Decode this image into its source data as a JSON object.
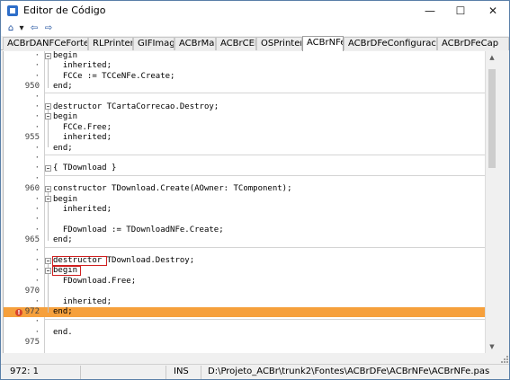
{
  "window": {
    "title": "Editor de Código",
    "controls": {
      "minimize": "—",
      "maximize": "☐",
      "close": "✕"
    }
  },
  "toolbar": {
    "buttons": [
      {
        "name": "home-icon",
        "glyph": "⌂"
      },
      {
        "name": "dropdown-arrow-icon",
        "glyph": "▾"
      },
      {
        "name": "back-icon",
        "glyph": "⇦"
      },
      {
        "name": "forward-icon",
        "glyph": "⇨"
      }
    ]
  },
  "tabs": [
    {
      "label": "ACBrDANFCeFortesFr",
      "active": false
    },
    {
      "label": "RLPrinters",
      "active": false
    },
    {
      "label": "GIFImage",
      "active": false
    },
    {
      "label": "ACBrMail",
      "active": false
    },
    {
      "label": "ACBrCEP",
      "active": false
    },
    {
      "label": "OSPrinters",
      "active": false
    },
    {
      "label": "ACBrNFe",
      "active": true
    },
    {
      "label": "ACBrDFeConfiguracoes",
      "active": false
    },
    {
      "label": "ACBrDFeCap",
      "active": false
    }
  ],
  "editor": {
    "lines": [
      {
        "ln": "·",
        "code": "begin"
      },
      {
        "ln": "·",
        "code": "  inherited;"
      },
      {
        "ln": "·",
        "code": "  FCCe := TCCeNFe.Create;"
      },
      {
        "ln": "950",
        "code": "end;"
      },
      {
        "ln": "·",
        "code": ""
      },
      {
        "ln": "·",
        "code": "destructor TCartaCorrecao.Destroy;"
      },
      {
        "ln": "·",
        "code": "begin"
      },
      {
        "ln": "·",
        "code": "  FCCe.Free;"
      },
      {
        "ln": "955",
        "code": "  inherited;"
      },
      {
        "ln": "·",
        "code": "end;"
      },
      {
        "ln": "·",
        "code": ""
      },
      {
        "ln": "·",
        "code": "{ TDownload }"
      },
      {
        "ln": "·",
        "code": ""
      },
      {
        "ln": "960",
        "code": "constructor TDownload.Create(AOwner: TComponent);"
      },
      {
        "ln": "·",
        "code": "begin"
      },
      {
        "ln": "·",
        "code": "  inherited;"
      },
      {
        "ln": "·",
        "code": ""
      },
      {
        "ln": "·",
        "code": "  FDownload := TDownloadNFe.Create;"
      },
      {
        "ln": "965",
        "code": "end;"
      },
      {
        "ln": "·",
        "code": ""
      },
      {
        "ln": "·",
        "code": "destructor TDownload.Destroy;"
      },
      {
        "ln": "·",
        "code": "begin"
      },
      {
        "ln": "·",
        "code": "  FDownload.Free;"
      },
      {
        "ln": "970",
        "code": ""
      },
      {
        "ln": "·",
        "code": "  inherited;"
      },
      {
        "ln": "972",
        "code": "end;"
      },
      {
        "ln": "·",
        "code": ""
      },
      {
        "ln": "·",
        "code": "end."
      },
      {
        "ln": "975",
        "code": ""
      }
    ],
    "current_line_color": "#f6a03c",
    "breakpoint_glyph": "!"
  },
  "scrollbar": {
    "up": "▲",
    "down": "▼"
  },
  "status": {
    "position": "972:  1",
    "mode": "INS",
    "path": "D:\\Projeto_ACBr\\trunk2\\Fontes\\ACBrDFe\\ACBrNFe\\ACBrNFe.pas"
  }
}
